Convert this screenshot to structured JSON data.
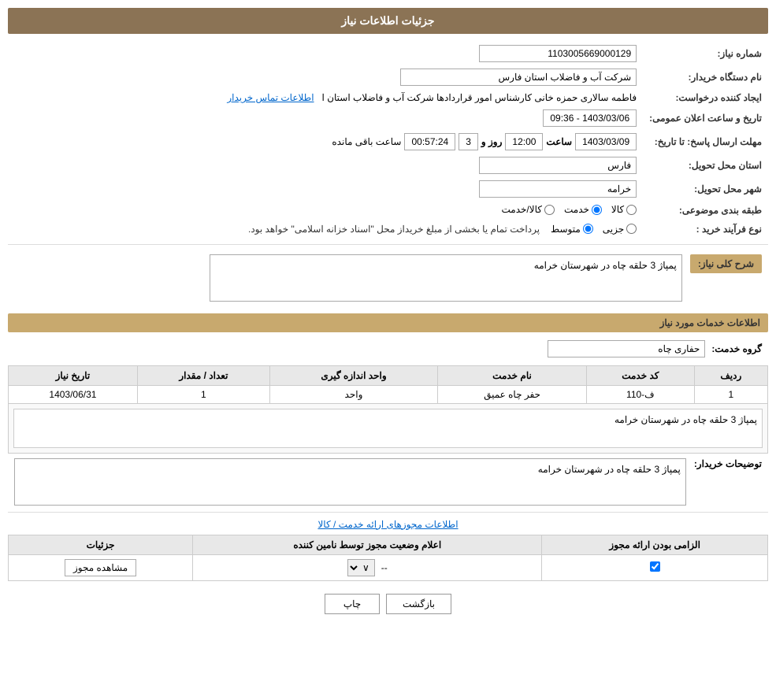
{
  "page": {
    "title": "جزئیات اطلاعات نیاز"
  },
  "header": {
    "need_number_label": "شماره نیاز:",
    "need_number_value": "1103005669000129",
    "buyer_org_label": "نام دستگاه خریدار:",
    "buyer_org_value": "شرکت آب و فاضلاب استان فارس",
    "creator_label": "ایجاد کننده درخواست:",
    "creator_value": "فاطمه سالاری حمزه خانی کارشناس امور قراردادها شرکت آب و فاضلاب استان ا",
    "creator_link": "اطلاعات تماس خریدار",
    "announce_datetime_label": "تاریخ و ساعت اعلان عمومی:",
    "announce_datetime_value": "1403/03/06 - 09:36",
    "reply_deadline_label": "مهلت ارسال پاسخ: تا تاریخ:",
    "reply_date": "1403/03/09",
    "reply_time_label": "ساعت",
    "reply_time": "12:00",
    "reply_days_label": "روز و",
    "reply_days": "3",
    "reply_remaining_label": "ساعت باقی مانده",
    "reply_remaining": "00:57:24",
    "province_label": "استان محل تحویل:",
    "province_value": "فارس",
    "city_label": "شهر محل تحویل:",
    "city_value": "خرامه",
    "category_label": "طبقه بندی موضوعی:",
    "category_options": [
      "کالا",
      "خدمت",
      "کالا/خدمت"
    ],
    "category_selected": "خدمت",
    "purchase_type_label": "نوع فرآیند خرید :",
    "purchase_options": [
      "جزیی",
      "متوسط"
    ],
    "purchase_selected": "متوسط",
    "purchase_note": "پرداخت تمام یا بخشی از مبلغ خریداز محل \"اسناد خزانه اسلامی\" خواهد بود."
  },
  "need_description": {
    "section_title": "شرح کلی نیاز:",
    "value": "پمپاژ 3 حلقه چاه در شهرستان خرامه"
  },
  "service_info": {
    "section_title": "اطلاعات خدمات مورد نیاز",
    "service_group_label": "گروه خدمت:",
    "service_group_value": "حفاری چاه",
    "table": {
      "columns": [
        "ردیف",
        "کد خدمت",
        "نام خدمت",
        "واحد اندازه گیری",
        "تعداد / مقدار",
        "تاریخ نیاز"
      ],
      "rows": [
        {
          "row_num": "1",
          "service_code": "ف-110",
          "service_name": "حفر چاه عمیق",
          "unit": "واحد",
          "quantity": "1",
          "need_date": "1403/06/31"
        }
      ]
    },
    "buyer_notes_label": "توضیحات خریدار:",
    "buyer_notes_value": "پمپاژ 3 حلقه چاه در شهرستان خرامه"
  },
  "permit_info": {
    "section_link": "اطلاعات مجوزهای ارائه خدمت / کالا",
    "table": {
      "columns": [
        "الزامی بودن ارائه مجوز",
        "اعلام وضعیت مجوز توسط نامین کننده",
        "جزئیات"
      ],
      "rows": [
        {
          "required": true,
          "status": "--",
          "detail_btn": "مشاهده مجوز"
        }
      ]
    }
  },
  "buttons": {
    "print": "چاپ",
    "back": "بازگشت"
  }
}
